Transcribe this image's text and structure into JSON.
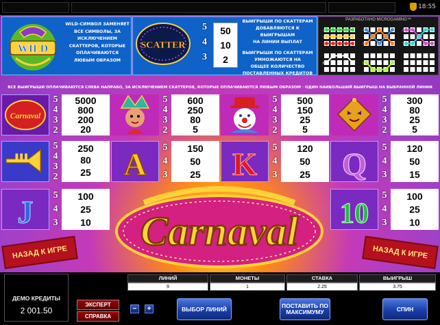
{
  "top_bar": {
    "clock": "18:55"
  },
  "wild": {
    "desc_lines": [
      "WILD-СИМВОЛ ЗАМЕНЯЕТ",
      "ВСЕ СИМВОЛЫ, ЗА",
      "ИСКЛЮЧЕНИЕМ",
      "СКАТТЕРОВ, КОТОРЫЕ",
      "ОПЛАЧИВАЮТСЯ",
      "ЛЮБЫМ ОБРАЗОМ"
    ],
    "logo_text": "WILD"
  },
  "scatter": {
    "logo_text": "SCATTER",
    "counts": [
      "5",
      "4",
      "3"
    ],
    "pays": [
      "50",
      "10",
      "2"
    ],
    "desc_lines": [
      "ВЫИГРЫШИ ПО СКАТТЕРАМ",
      "ДОБАВЛЯЮТСЯ К ВЫИГРЫШАМ",
      "НА ЛИНИИ ВЫПЛАТ",
      "",
      "ВЫИГРЫШИ ПО СКАТТЕРАМ",
      "УМНОЖАЮТСЯ НА",
      "ОБЩЕЕ КОЛИЧЕСТВО",
      "ПОСТАВЛЕННЫХ КРЕДИТОВ"
    ]
  },
  "paylines": {
    "title": "РАЗРАБОТАНО MICROGAMING™",
    "labels": [
      "1",
      "2",
      "3",
      "4",
      "5",
      "6",
      "7",
      "8",
      "9"
    ]
  },
  "rules_line": "ВСЕ ВЫИГРЫШИ ОПЛАЧИВАЮТСЯ СЛЕВА НАПРАВО, ЗА ИСКЛЮЧЕНИЕМ СКАТТЕРОВ, КОТОРЫЕ ОПЛАЧИВАЮТСЯ ЛЮБЫМ ОБРАЗОМ · ОДИН НАИБОЛЬШИЙ ВЫИГРЫШ НА ВЫБРАННОЙ ЛИНИИ",
  "symbols": [
    {
      "id": "carnaval",
      "name": "Carnaval",
      "counts": [
        "5",
        "4",
        "3",
        "2"
      ],
      "pays": [
        "5000",
        "800",
        "200",
        "20"
      ]
    },
    {
      "id": "dancer",
      "name": "",
      "counts": [
        "5",
        "4",
        "3",
        "2"
      ],
      "pays": [
        "600",
        "250",
        "80",
        "5"
      ]
    },
    {
      "id": "clown",
      "name": "",
      "counts": [
        "5",
        "4",
        "3",
        "2"
      ],
      "pays": [
        "500",
        "150",
        "25",
        "5"
      ]
    },
    {
      "id": "jester",
      "name": "",
      "counts": [
        "5",
        "4",
        "3",
        "2"
      ],
      "pays": [
        "300",
        "80",
        "25",
        "5"
      ]
    },
    {
      "id": "trumpet",
      "name": "",
      "counts": [
        "5",
        "4",
        "3",
        "2"
      ],
      "pays": [
        "250",
        "80",
        "25",
        ""
      ]
    },
    {
      "id": "A",
      "name": "A",
      "counts": [
        "5",
        "4",
        "3"
      ],
      "pays": [
        "150",
        "50",
        "25"
      ]
    },
    {
      "id": "K",
      "name": "K",
      "counts": [
        "5",
        "4",
        "3"
      ],
      "pays": [
        "120",
        "50",
        "25"
      ]
    },
    {
      "id": "Q",
      "name": "Q",
      "counts": [
        "5",
        "4",
        "3"
      ],
      "pays": [
        "120",
        "50",
        "15"
      ]
    },
    {
      "id": "J",
      "name": "J",
      "counts": [
        "5",
        "4",
        "3"
      ],
      "pays": [
        "100",
        "25",
        "10"
      ]
    },
    {
      "id": "10",
      "name": "10",
      "counts": [
        "5",
        "4",
        "3"
      ],
      "pays": [
        "100",
        "25",
        "10"
      ]
    }
  ],
  "logo": "Carnaval",
  "back_to_game": "НАЗАД К ИГРЕ",
  "controls": {
    "credit_label": "ДЕМО КРЕДИТЫ",
    "credit_value": "2 001.50",
    "expert": "ЭКСПЕРТ",
    "help": "СПРАВКА",
    "minus": "−",
    "plus": "+",
    "lines_label": "ЛИНИЙ",
    "lines_value": "9",
    "coins_label": "МОНЕТЫ",
    "coins_value": "1",
    "bet_label": "СТАВКА",
    "bet_value": "2.25",
    "win_label": "ВЫИГРЫШ",
    "win_value": "3.75",
    "select_lines": "ВЫБОР ЛИНИЙ",
    "bet_max": "ПОСТАВИТЬ ПО МАКСИМУМУ",
    "spin": "СПИН"
  },
  "colors": {
    "panel_blue": "#0e62c8",
    "ribbon_red": "#b4101e",
    "button_blue": "#1a3ea8",
    "gold": "#ffd23a"
  }
}
